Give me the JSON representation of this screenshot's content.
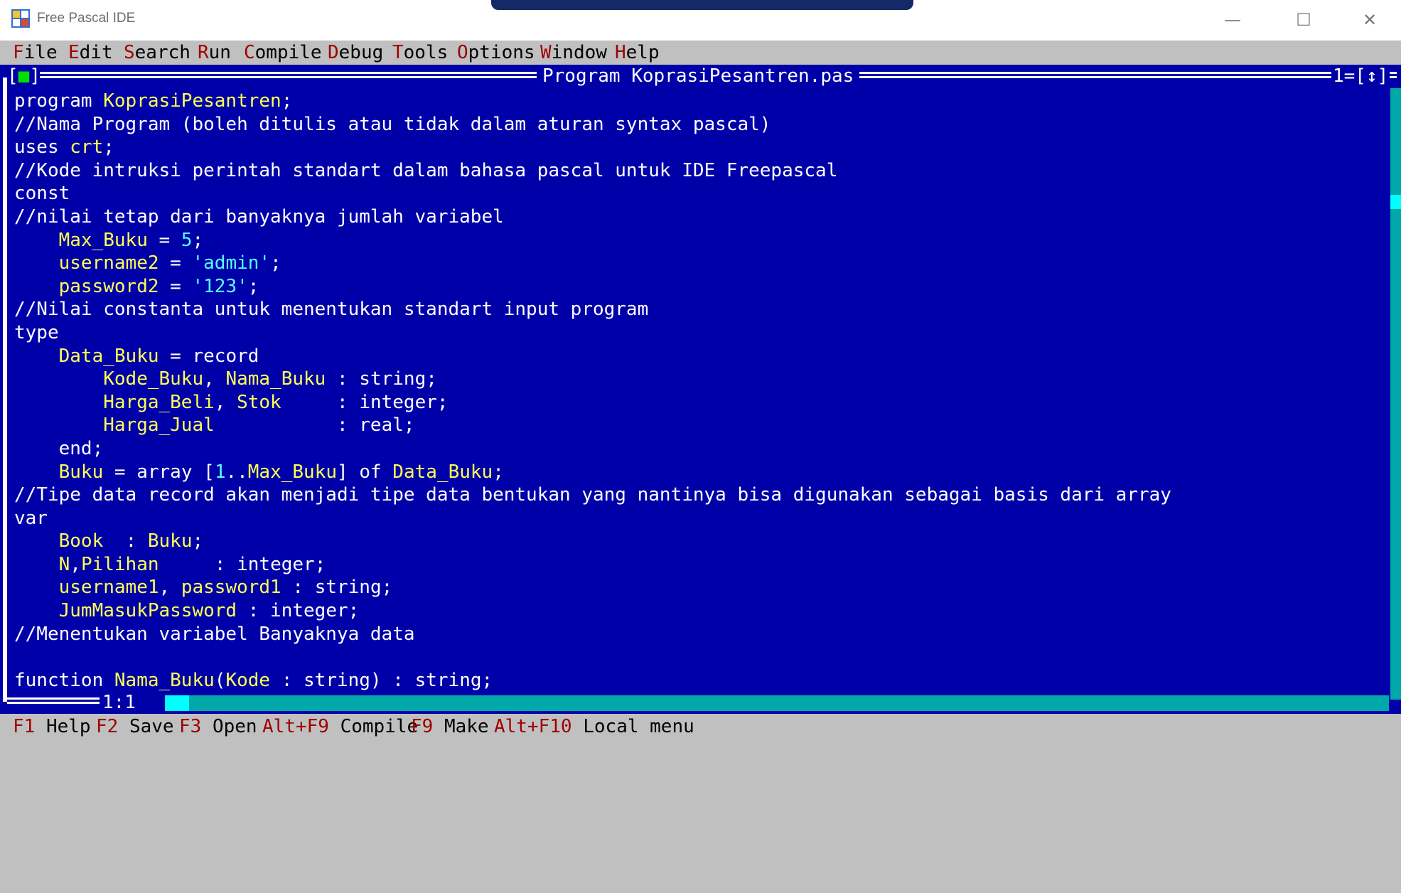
{
  "window": {
    "title": "Free Pascal IDE",
    "icon": "free-pascal-icon"
  },
  "menu": [
    {
      "hot": "F",
      "rest": "ile"
    },
    {
      "hot": "E",
      "rest": "dit"
    },
    {
      "hot": "S",
      "rest": "earch"
    },
    {
      "hot": "R",
      "rest": "un"
    },
    {
      "hot": "C",
      "rest": "ompile"
    },
    {
      "hot": "D",
      "rest": "ebug"
    },
    {
      "hot": "T",
      "rest": "ools"
    },
    {
      "hot": "O",
      "rest": "ptions"
    },
    {
      "hot": "W",
      "rest": "indow"
    },
    {
      "hot": "H",
      "rest": "elp"
    }
  ],
  "editor": {
    "title": "Program KoprasiPesantren.pas",
    "close_box": "[■]",
    "window_number": "1=[↕]",
    "cursor": "1:1"
  },
  "code_lines": [
    "program KoprasiPesantren;",
    "//Nama Program (boleh ditulis atau tidak dalam aturan syntax pascal)",
    "uses crt;",
    "//Kode intruksi perintah standart dalam bahasa pascal untuk IDE Freepascal",
    "const",
    "//nilai tetap dari banyaknya jumlah variabel",
    "    Max_Buku = 5;",
    "    username2 = 'admin';",
    "    password2 = '123';",
    "//Nilai constanta untuk menentukan standart input program",
    "type",
    "    Data_Buku = record",
    "        Kode_Buku, Nama_Buku : string;",
    "        Harga_Beli, Stok     : integer;",
    "        Harga_Jual           : real;",
    "    end;",
    "    Buku = array [1..Max_Buku] of Data_Buku;",
    "//Tipe data record akan menjadi tipe data bentukan yang nantinya bisa digunakan sebagai basis dari array",
    "var",
    "    Book  : Buku;",
    "    N,Pilihan     : integer;",
    "    username1, password1 : string;",
    "    JumMasukPassword : integer;",
    "//Menentukan variabel Banyaknya data",
    "",
    "function Nama_Buku(Kode : string) : string;"
  ],
  "status": [
    {
      "key": "F1",
      "label": "Help"
    },
    {
      "key": "F2",
      "label": "Save"
    },
    {
      "key": "F3",
      "label": "Open"
    },
    {
      "key": "Alt+F9",
      "label": "Compile"
    },
    {
      "key": "F9",
      "label": "Make"
    },
    {
      "key": "Alt+F10",
      "label": "Local menu"
    }
  ],
  "colors": {
    "editor_bg": "#0000a8",
    "identifier": "#ffff55",
    "string_literal": "#55ffff",
    "hotkey": "#a00000",
    "scrollbar": "#00a8a8"
  }
}
